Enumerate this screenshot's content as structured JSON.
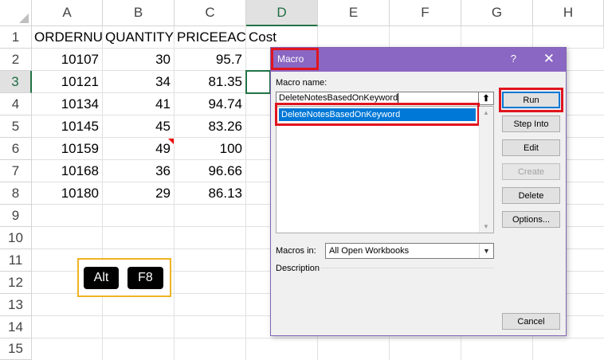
{
  "sheet": {
    "columns": [
      "A",
      "B",
      "C",
      "D",
      "E",
      "F",
      "G",
      "H"
    ],
    "rows": [
      "1",
      "2",
      "3",
      "4",
      "5",
      "6",
      "7",
      "8",
      "9",
      "10",
      "11",
      "12",
      "13",
      "14",
      "15"
    ],
    "headers": {
      "a1": "ORDERNU",
      "b1": "QUANTITY",
      "c1": "PRICEEACH",
      "d1": "Cost"
    },
    "data": [
      {
        "a": "10107",
        "b": "30",
        "c": "95.7"
      },
      {
        "a": "10121",
        "b": "34",
        "c": "81.35"
      },
      {
        "a": "10134",
        "b": "41",
        "c": "94.74"
      },
      {
        "a": "10145",
        "b": "45",
        "c": "83.26"
      },
      {
        "a": "10159",
        "b": "49",
        "c": "100"
      },
      {
        "a": "10168",
        "b": "36",
        "c": "96.66"
      },
      {
        "a": "10180",
        "b": "29",
        "c": "86.13"
      }
    ],
    "selected_column": "D",
    "selected_row": "3"
  },
  "keys": {
    "alt": "Alt",
    "f8": "F8",
    "border_color": "#f0b323"
  },
  "dialog": {
    "title": "Macro",
    "help": "?",
    "close": "✕",
    "macro_name_label": "Macro name:",
    "macro_name_value": "DeleteNotesBasedOnKeyword",
    "list_items": [
      "DeleteNotesBasedOnKeyword"
    ],
    "macros_in_label": "Macros in:",
    "macros_in_value": "All Open Workbooks",
    "description_label": "Description",
    "buttons": {
      "run": "Run",
      "step_into": "Step Into",
      "edit": "Edit",
      "create": "Create",
      "delete": "Delete",
      "options": "Options...",
      "cancel": "Cancel"
    },
    "titlebar_color": "#8a67c2",
    "highlight_color": "#e0141e",
    "selection_color": "#0078d7"
  }
}
